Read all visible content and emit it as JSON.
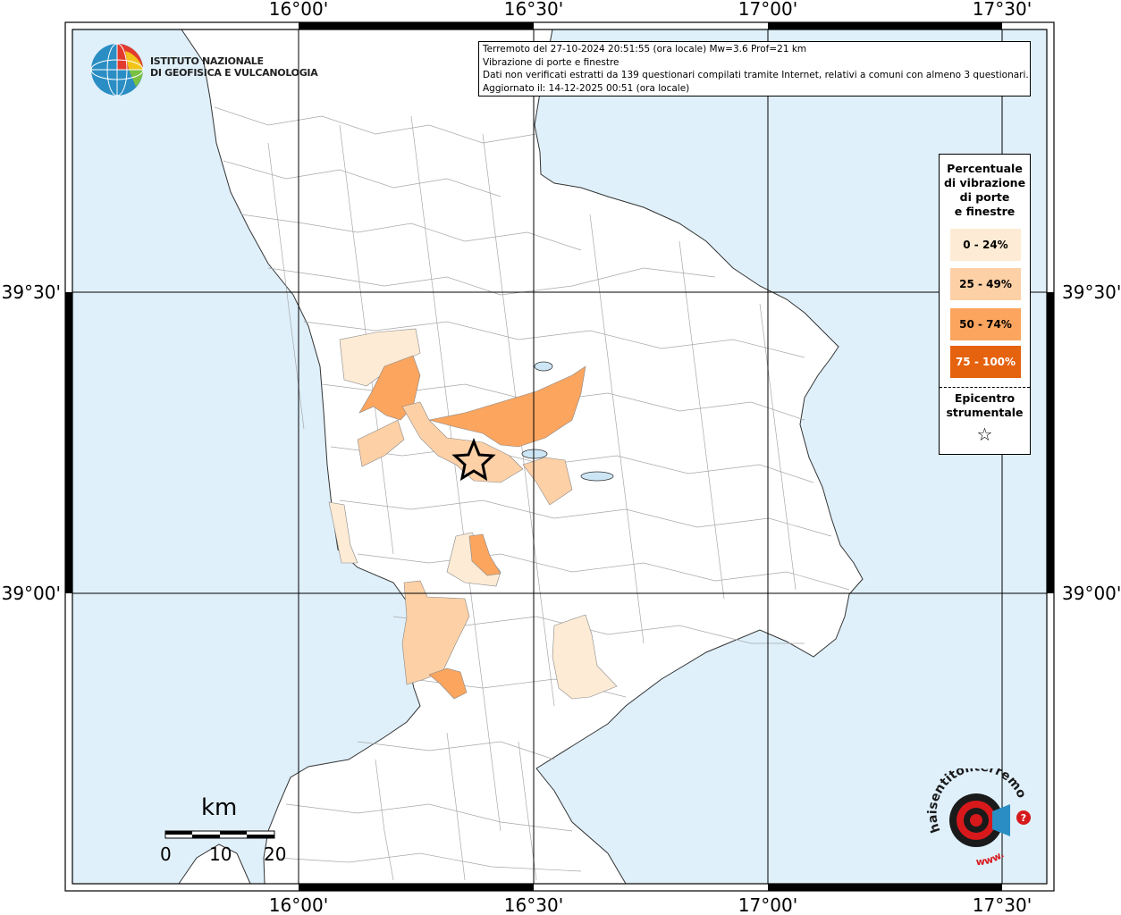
{
  "map_frame": {
    "lon_labels": [
      "16°00'",
      "16°30'",
      "17°00'",
      "17°30'"
    ],
    "lat_labels": [
      "39°30'",
      "39°00'"
    ]
  },
  "info_box": {
    "line1": "Terremoto del 27-10-2024 20:51:55 (ora locale) Mw=3.6 Prof=21 km",
    "line2": "Vibrazione di porte e finestre",
    "line3": "Dati non verificati estratti da 139 questionari compilati tramite Internet, relativi a comuni con almeno 3 questionari.",
    "line4": "Aggiornato il: 14-12-2025 00:51 (ora locale)"
  },
  "logo": {
    "name_line1": "ISTITUTO NAZIONALE",
    "name_line2": "DI GEOFISICA E VULCANOLOGIA"
  },
  "legend": {
    "title_lines": [
      "Percentuale",
      "di vibrazione",
      "di porte",
      "e finestre"
    ],
    "classes": [
      {
        "label": "0 - 24%",
        "color": "#fdebd5"
      },
      {
        "label": "25 - 49%",
        "color": "#fdd0a6"
      },
      {
        "label": "50 - 74%",
        "color": "#fba55f"
      },
      {
        "label": "75 - 100%",
        "color": "#e5620e"
      }
    ],
    "epicenter_lines": [
      "Epicentro",
      "strumentale"
    ],
    "epicenter_symbol": "☆"
  },
  "scale_bar": {
    "unit": "km",
    "ticks": [
      "0",
      "10",
      "20"
    ]
  },
  "colors": {
    "sea": "#dff0fb",
    "land": "#ffffff",
    "boundary": "#9a9a9a",
    "class_0_24": "#fdebd5",
    "class_25_49": "#fdd0a6",
    "class_50_74": "#fba55f",
    "class_75_100": "#e5620e"
  },
  "watermark": {
    "text": "haisentitoilterremoto.it",
    "prefix": "www."
  }
}
